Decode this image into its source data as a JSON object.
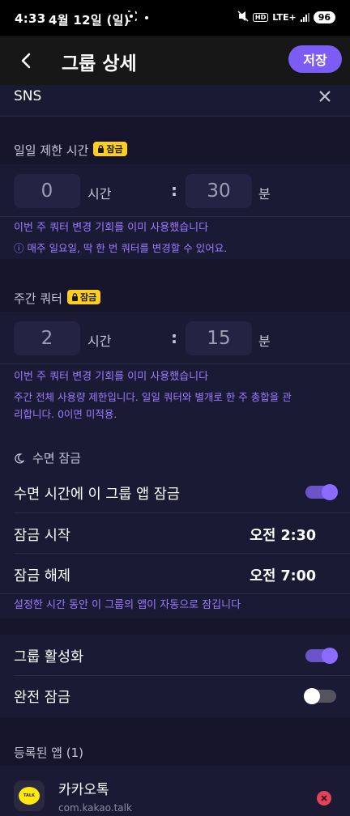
{
  "status_bar": {
    "time": "4:33",
    "date": "4월 12일 (일)",
    "network": "LTE+",
    "battery": "96"
  },
  "header": {
    "title": "그룹 상세",
    "save_label": "저장"
  },
  "group_name": {
    "value": "SNS"
  },
  "daily_limit": {
    "label": "일일 제한 시간",
    "badge": "잠금",
    "hours": "0",
    "hours_unit": "시간",
    "separator": ":",
    "minutes": "30",
    "minutes_unit": "분",
    "note": "이번 주 쿼터 변경 기회를 이미 사용했습니다",
    "info_line1": "ⓘ 매주 일요일, 딱 한 번 쿼터를 변경할 수 있어요."
  },
  "weekly_quota": {
    "label": "주간 쿼터",
    "badge": "잠금",
    "hours": "2",
    "hours_unit": "시간",
    "separator": ":",
    "minutes": "15",
    "minutes_unit": "분",
    "note": "이번 주 쿼터 변경 기회를 이미 사용했습니다",
    "info_line1": "주간 전체 사용량 제한입니다. 일일 쿼터와 별개로 한 주 총합을 관",
    "info_line2": "리합니다. 0이면 미적용."
  },
  "sleep_lock": {
    "section_label": "수면 잠금",
    "toggle_label": "수면 시간에 이 그룹 앱 잠금",
    "toggle_on": true,
    "start_label": "잠금 시작",
    "start_value": "오전 2:30",
    "end_label": "잠금 해제",
    "end_value": "오전 7:00",
    "note": "설정한 시간 동안 이 그룹의 앱이 자동으로 잠깁니다"
  },
  "group_settings": {
    "activate_label": "그룹 활성화",
    "activate_on": true,
    "full_lock_label": "완전 잠금",
    "full_lock_on": false
  },
  "registered_apps": {
    "label": "등록된 앱 (1)",
    "items": [
      {
        "name": "카카오톡",
        "package": "com.kakao.talk",
        "icon_text": "TALK"
      }
    ]
  },
  "colors": {
    "accent": "#7b5cf5",
    "note_purple": "#9c7cff",
    "badge_yellow": "#ffcf1f",
    "remove_red": "#e0445a",
    "background": "#16152b"
  }
}
